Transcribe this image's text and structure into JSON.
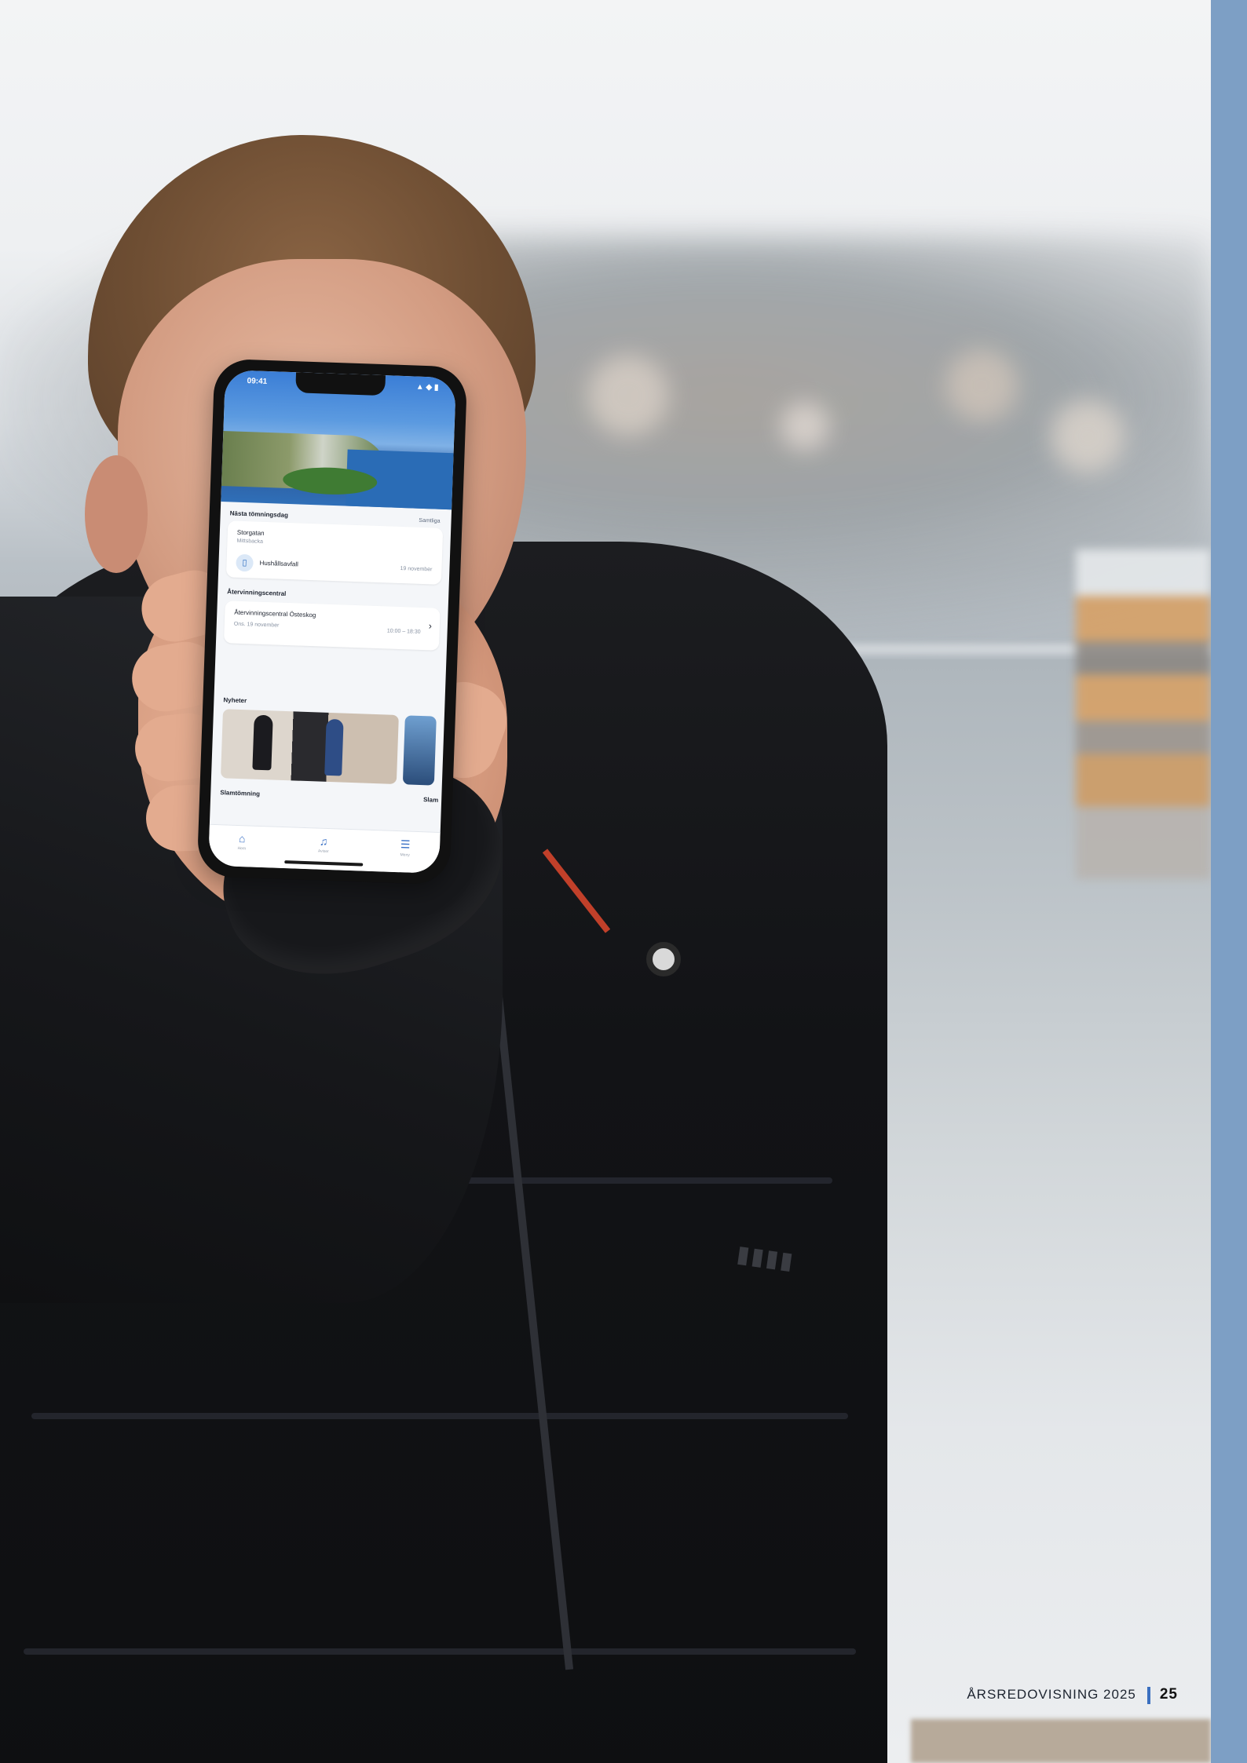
{
  "footer": {
    "title": "ÅRSREDOVISNING 2025",
    "page_number": "25"
  },
  "phone": {
    "status_time": "09:41",
    "status_icons": "▲ ◆ ▮",
    "section_next_collection": "Nästa tömningsdag",
    "section_next_collection_link": "Samtliga",
    "collection_card": {
      "line1": "Storgatan",
      "line2": "Mittsbacka",
      "type": "Hushållsavfall",
      "date": "19 november"
    },
    "section_recycling": "Återvinningscentral",
    "recycling_card": {
      "name": "Återvinningscentral Östeskog",
      "day": "Ons. 19 november",
      "hours": "10:00 – 18:30"
    },
    "section_news": "Nyheter",
    "section_service": "Slamtömning",
    "section_service_right": "Slam",
    "tabs": [
      {
        "icon": "home-icon",
        "label": "Hem"
      },
      {
        "icon": "bell-icon",
        "label": "Aviser"
      },
      {
        "icon": "menu-icon",
        "label": "Meny"
      }
    ]
  }
}
